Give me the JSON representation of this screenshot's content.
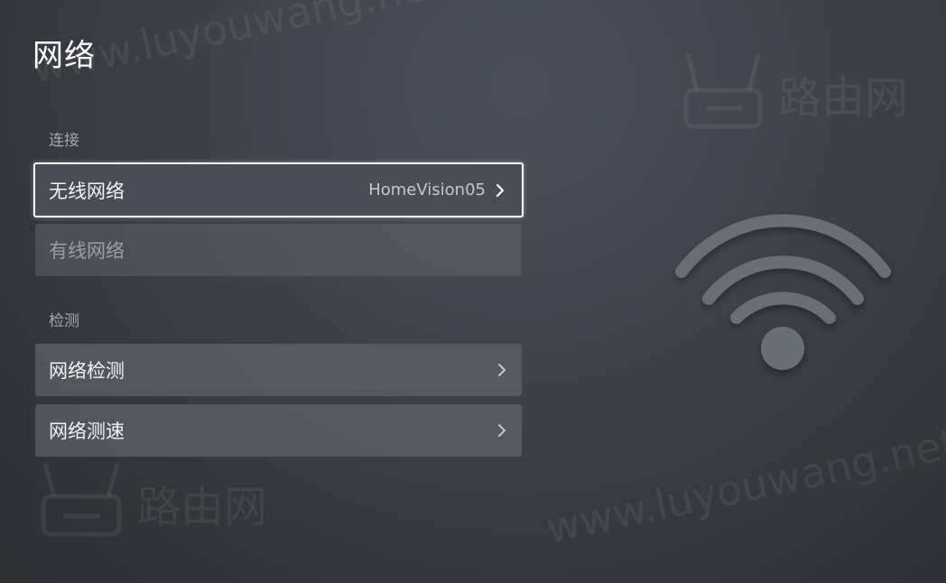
{
  "header": {
    "title": "网络"
  },
  "sections": [
    {
      "label": "连接",
      "items": [
        {
          "label": "无线网络",
          "value": "HomeVision05",
          "state": "focused",
          "icon": "chevron-right-icon"
        },
        {
          "label": "有线网络",
          "value": "",
          "state": "disabled"
        }
      ]
    },
    {
      "label": "检测",
      "items": [
        {
          "label": "网络检测",
          "value": "",
          "state": "normal",
          "icon": "chevron-right-icon"
        },
        {
          "label": "网络测速",
          "value": "",
          "state": "normal",
          "icon": "chevron-right-icon"
        }
      ]
    }
  ],
  "illustration": {
    "icon": "wifi-icon",
    "color": "#6b6e74"
  },
  "watermark": {
    "url_text": "www.luyouwang.net",
    "brand_text": "路由网"
  },
  "colors": {
    "focus_border": "#ffffff",
    "row_background": "#5f626a",
    "secondary_text": "#a4a7ad"
  }
}
